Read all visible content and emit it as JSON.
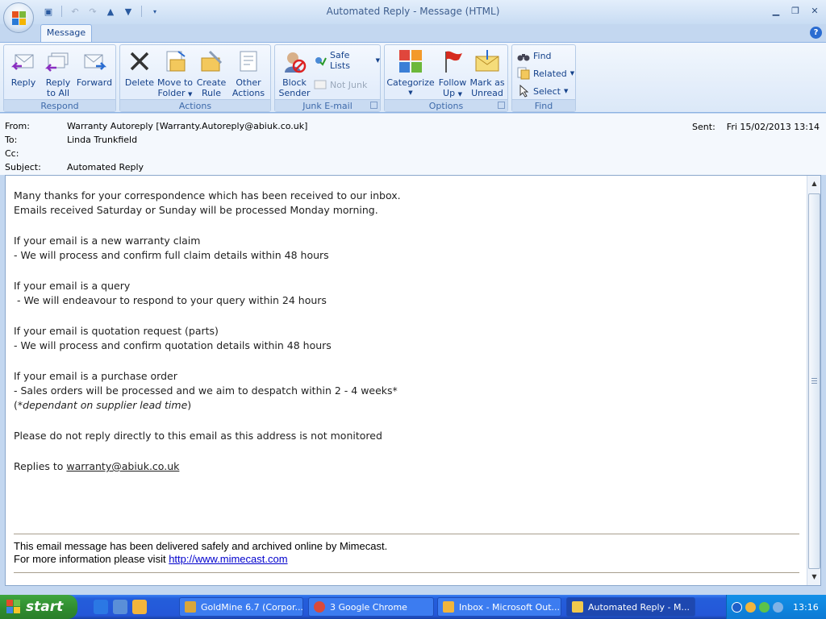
{
  "window": {
    "title": "Automated Reply - Message (HTML)"
  },
  "ribbon": {
    "tab": "Message",
    "groups": {
      "respond": {
        "label": "Respond",
        "reply": "Reply",
        "reply_all_1": "Reply",
        "reply_all_2": "to All",
        "forward": "Forward"
      },
      "actions": {
        "label": "Actions",
        "delete": "Delete",
        "move_1": "Move to",
        "move_2": "Folder",
        "create_1": "Create",
        "create_2": "Rule",
        "other_1": "Other",
        "other_2": "Actions"
      },
      "junk": {
        "label": "Junk E-mail",
        "block_1": "Block",
        "block_2": "Sender",
        "safe_lists": "Safe Lists",
        "not_junk": "Not Junk"
      },
      "options": {
        "label": "Options",
        "categorize": "Categorize",
        "follow_1": "Follow",
        "follow_2": "Up",
        "mark_1": "Mark as",
        "mark_2": "Unread"
      },
      "find": {
        "label": "Find",
        "find": "Find",
        "related": "Related",
        "select": "Select"
      }
    }
  },
  "header": {
    "from_label": "From:",
    "from_value": "Warranty Autoreply [Warranty.Autoreply@abiuk.co.uk]",
    "to_label": "To:",
    "to_value": "Linda Trunkfield",
    "cc_label": "Cc:",
    "cc_value": "",
    "subject_label": "Subject:",
    "subject_value": "Automated Reply",
    "sent_label": "Sent:",
    "sent_value": "Fri 15/02/2013 13:14"
  },
  "body": {
    "p1_l1": "Many thanks for your correspondence which has been received to our inbox.",
    "p1_l2": "Emails received Saturday or Sunday will be processed Monday morning.",
    "p2_l1": "If your email is a new warranty claim",
    "p2_l2": "- We will process and confirm full claim details within 48 hours",
    "p3_l1": "If your email is a query",
    "p3_l2": " - We will endeavour to respond to your query within 24 hours",
    "p4_l1": "If your email is quotation request (parts)",
    "p4_l2": "- We will process and confirm quotation details within 48 hours",
    "p5_l1": "If your email is a purchase order",
    "p5_l2": "- Sales orders will be processed and we aim to despatch within 2 - 4 weeks*",
    "p5_l3_open": "(*",
    "p5_l3_italic": "dependant on supplier lead time",
    "p5_l3_close": ")",
    "p6": "Please do not reply directly to this email as this address is not monitored",
    "p7_prefix": "Replies to ",
    "p7_link": "warranty@abiuk.co.uk",
    "footer_l1": "This email message has been delivered safely and archived online by Mimecast.",
    "footer_l2_prefix": "For more information please visit ",
    "footer_link": "http://www.mimecast.com"
  },
  "taskbar": {
    "start": "start",
    "items": [
      {
        "label": "GoldMine 6.7 (Corpor..."
      },
      {
        "label": "3 Google Chrome"
      },
      {
        "label": "Inbox - Microsoft Out..."
      },
      {
        "label": "Automated Reply - M..."
      }
    ],
    "clock": "13:16"
  },
  "colors": {
    "accent": "#15428b",
    "taskbar": "#245edb",
    "start": "#2f8b2f"
  }
}
